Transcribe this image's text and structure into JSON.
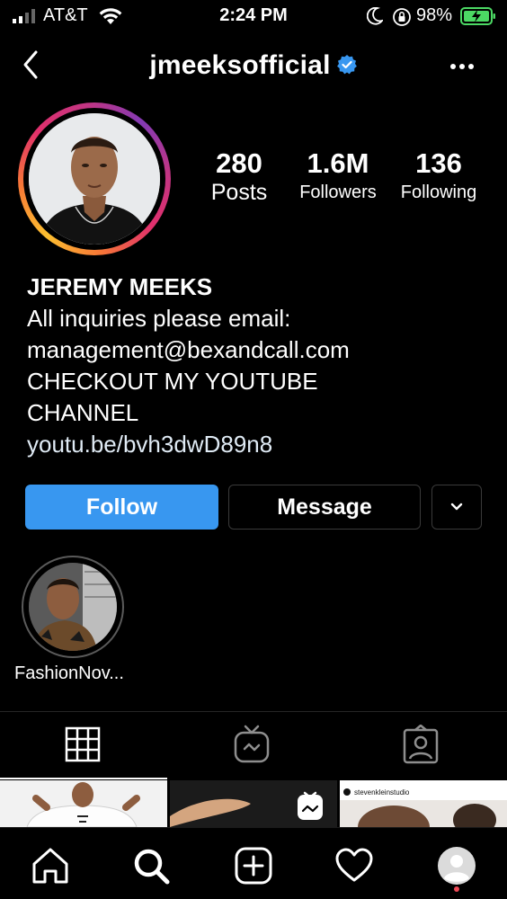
{
  "status_bar": {
    "carrier": "AT&T",
    "time": "2:24 PM",
    "battery_percent": "98%"
  },
  "header": {
    "username": "jmeeksofficial",
    "verified": true
  },
  "profile": {
    "stats": {
      "posts_count": "280",
      "posts_label": "Posts",
      "followers_count": "1.6M",
      "followers_label": "Followers",
      "following_count": "136",
      "following_label": "Following"
    },
    "bio": {
      "name": "JEREMY MEEKS",
      "line1": "All inquiries please email:",
      "line2": "management@bexandcall.com",
      "line3": "CHECKOUT MY YOUTUBE",
      "line4": "CHANNEL",
      "link": "youtu.be/bvh3dwD89n8"
    }
  },
  "actions": {
    "follow_label": "Follow",
    "message_label": "Message"
  },
  "highlights": [
    {
      "label": "FashionNov..."
    }
  ],
  "grid": {
    "cell3_caption": "stevenkleinstudio"
  },
  "colors": {
    "follow_button": "#3897f0",
    "verified_badge": "#3897f0",
    "notification_dot": "#ed4956",
    "background": "#000000"
  }
}
